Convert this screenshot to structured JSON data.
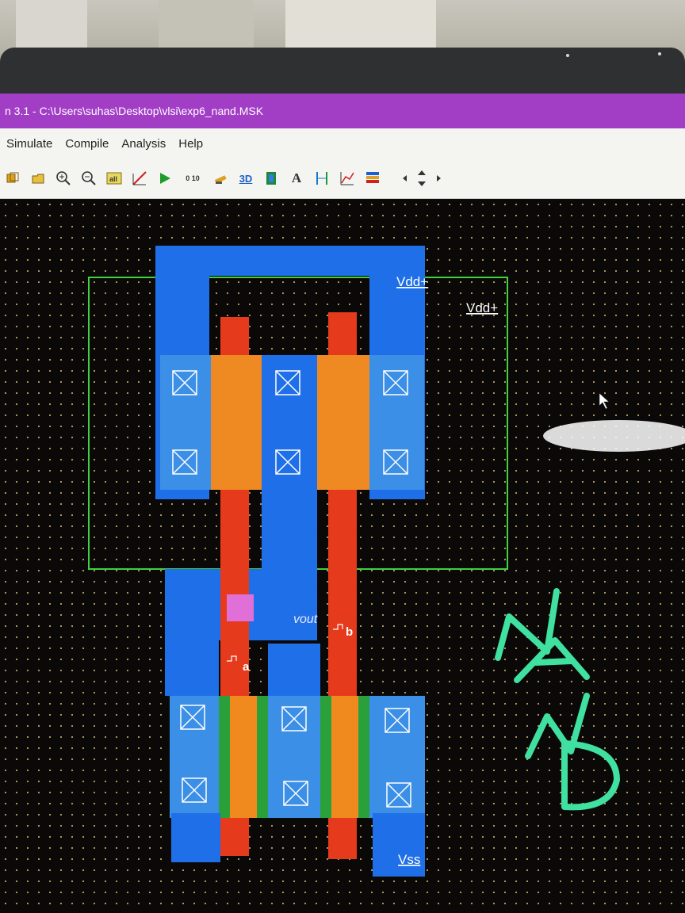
{
  "window": {
    "title": "n 3.1 - C:\\Users\\suhas\\Desktop\\vlsi\\exp6_nand.MSK"
  },
  "menu": {
    "items": [
      "Simulate",
      "Compile",
      "Analysis",
      "Help"
    ]
  },
  "toolbar": {
    "icons": [
      "layer-icon",
      "open-icon",
      "zoom-in-icon",
      "zoom-out-icon",
      "fit-icon",
      "measure-icon",
      "run-icon",
      "ruler-icon",
      "paint-icon",
      "3d-view-icon",
      "transistor-icon",
      "text-icon",
      "align-icon",
      "graph-icon",
      "palette-icon",
      "scroll-arrows-icon"
    ],
    "text_a": "A",
    "text_3d": "3D",
    "text_ruler": "0 10"
  },
  "layout": {
    "labels": {
      "vdd_1": "Vdd+",
      "vdd_2": "Vdd+",
      "vout": "vout",
      "a": "a",
      "b": "b",
      "vss": "Vss"
    },
    "handwritten_note": "NAND",
    "colors": {
      "metal": "#1f6fe8",
      "diffusion": "#3b8fe6",
      "poly": "#e53a1b",
      "poly_overlap_p": "#ef8a22",
      "poly_overlap_n": "#f08a1f",
      "nwell": "#40d040",
      "ndiff_edge": "#2aa03a",
      "contact": "#ffffff",
      "via": "#e070d8",
      "note": "#3fe0a0"
    }
  }
}
